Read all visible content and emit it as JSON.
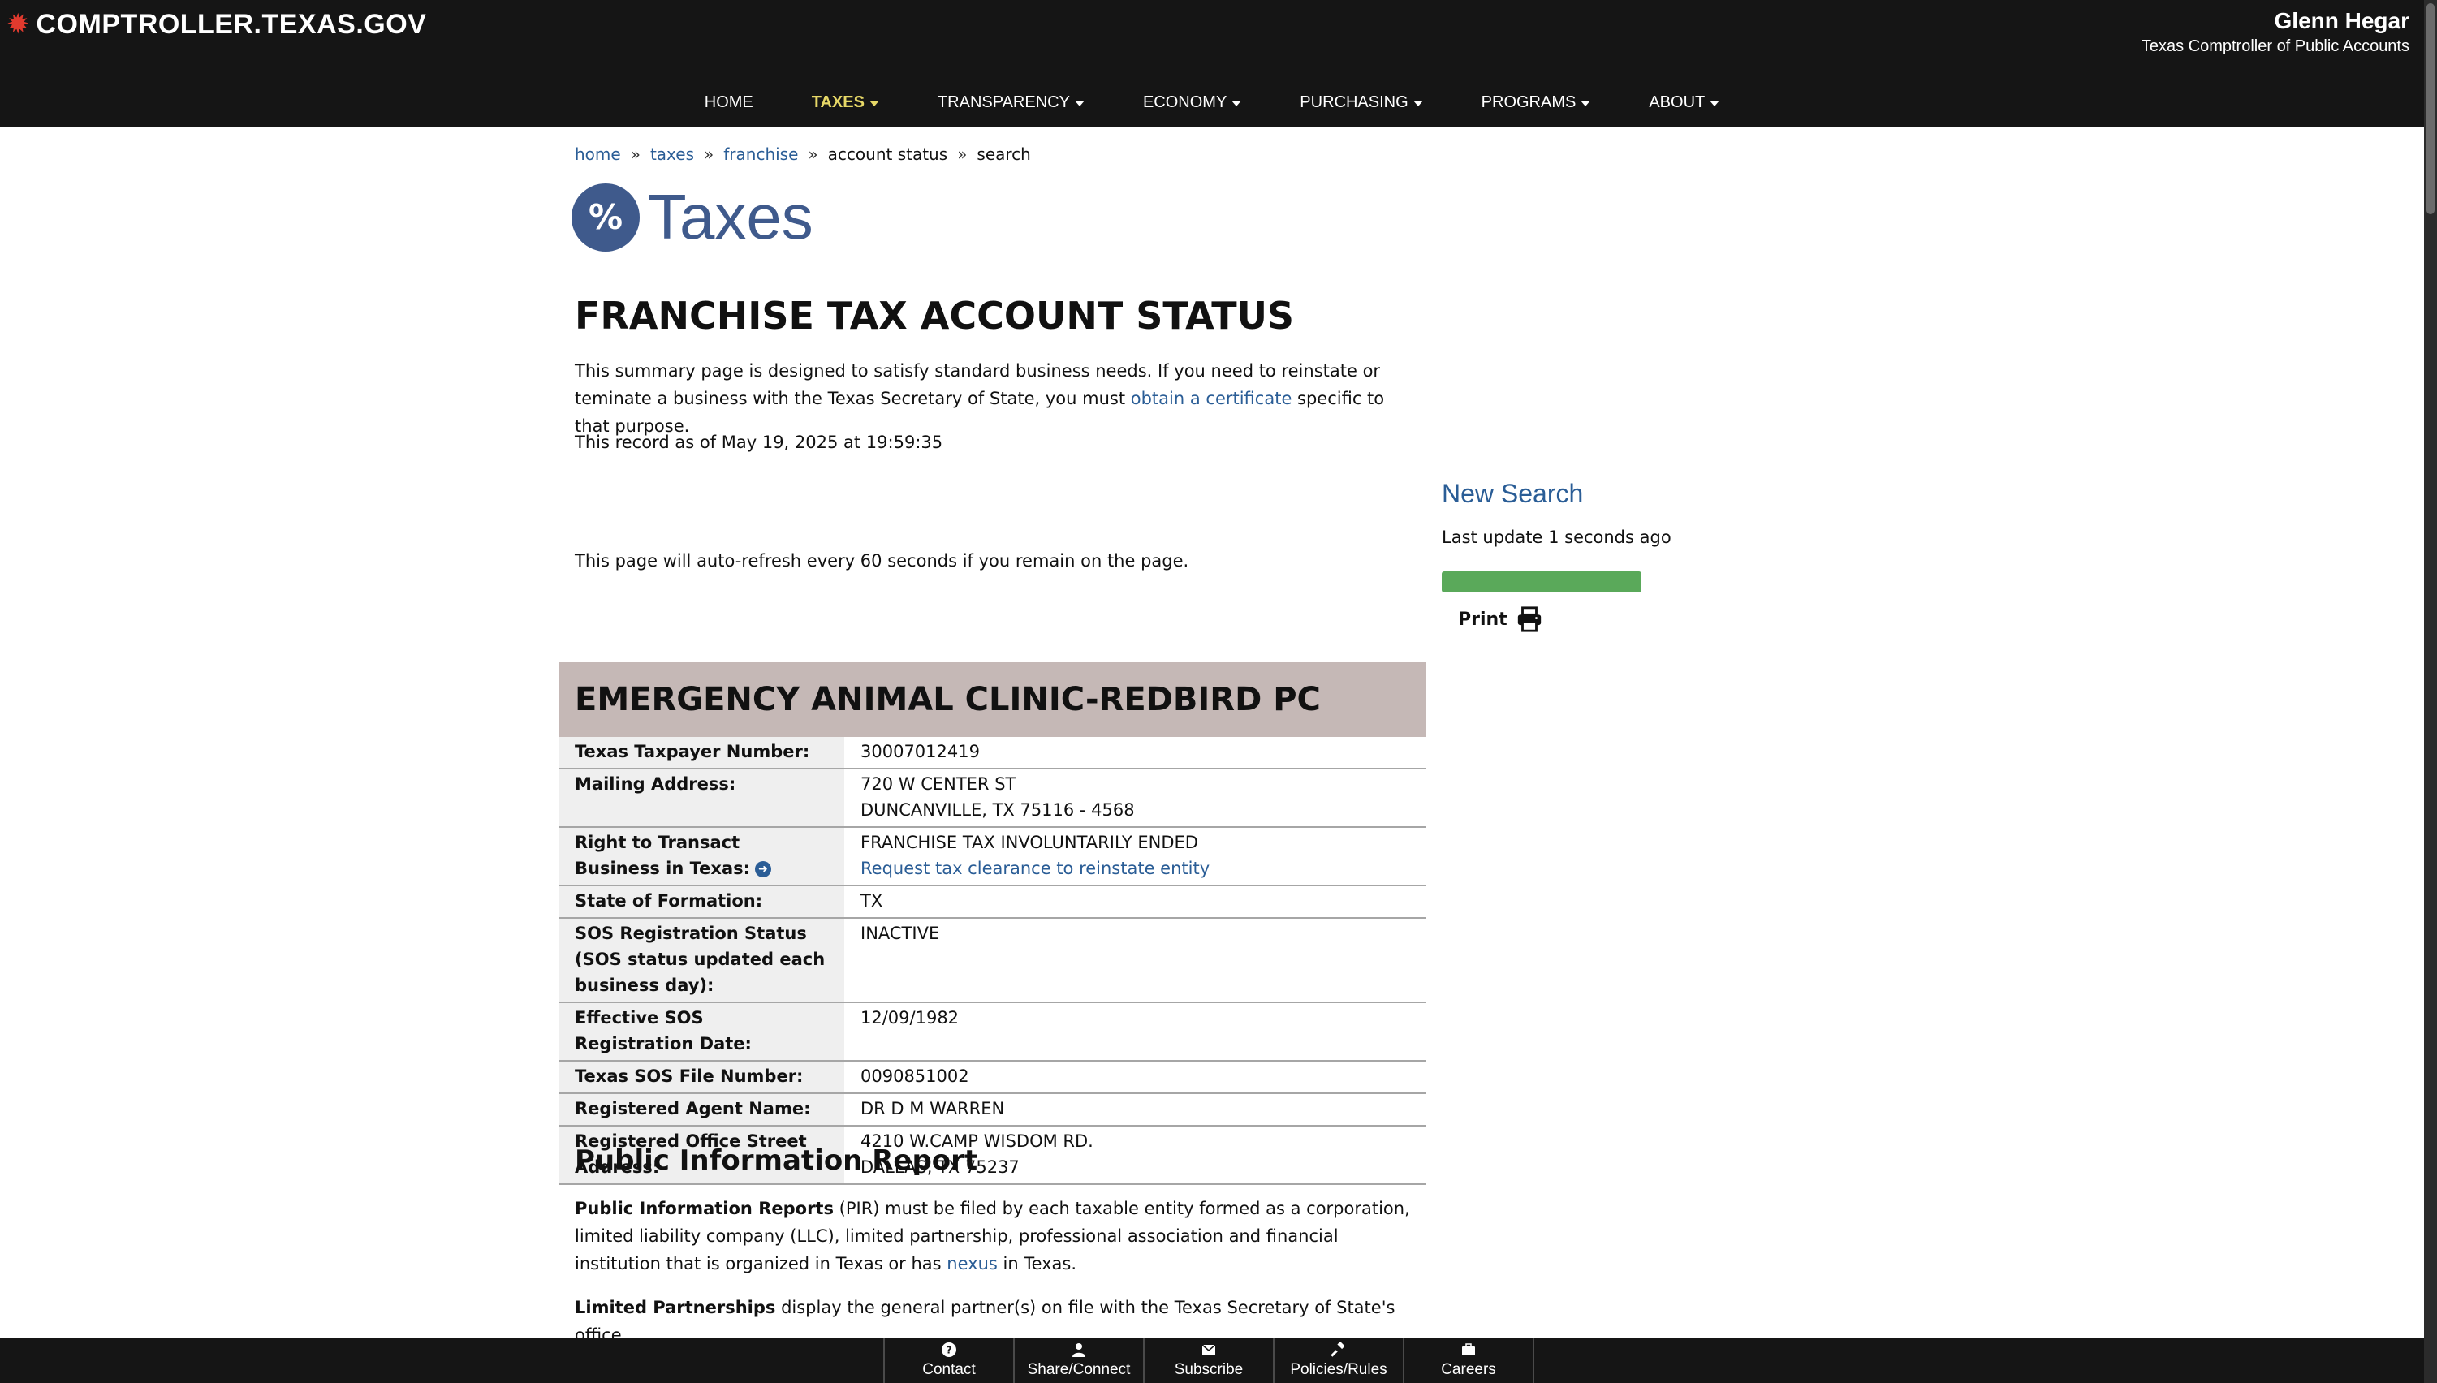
{
  "header": {
    "logo_text": "COMPTROLLER.TEXAS.GOV",
    "user_name": "Glenn Hegar",
    "user_title": "Texas Comptroller of Public Accounts"
  },
  "nav": [
    "HOME",
    "TAXES",
    "TRANSPARENCY",
    "ECONOMY",
    "PURCHASING",
    "PROGRAMS",
    "ABOUT"
  ],
  "breadcrumb": [
    "home",
    "taxes",
    "franchise",
    "account status",
    "search"
  ],
  "section": {
    "icon": "%",
    "label": "Taxes"
  },
  "page_title": "FRANCHISE TAX ACCOUNT STATUS",
  "intro": {
    "text_before": "This summary page is designed to satisfy standard business needs. If you need to reinstate or teminate a business with the Texas Secretary of State, you must ",
    "link": "obtain a certificate",
    "text_after": " specific to that purpose."
  },
  "record_as_of": "This record as of May 19, 2025 at 19:59:35",
  "auto_refresh": "This page will auto-refresh every 60 seconds if you remain on the page.",
  "sidebar": {
    "new_search": "New Search",
    "last_update": "Last update 1 seconds ago",
    "progress_percent": 100,
    "progress_color": "#5aa95a",
    "print_label": "Print"
  },
  "entity": {
    "name": "EMERGENCY ANIMAL CLINIC-REDBIRD PC",
    "rows": [
      {
        "label": "Texas Taxpayer Number:",
        "value": "30007012419"
      },
      {
        "label": "Mailing Address:",
        "value": "720 W CENTER ST",
        "value2": "DUNCANVILLE, TX 75116 - 4568"
      },
      {
        "label": "Right to Transact Business in Texas:",
        "value": "FRANCHISE TAX INVOLUNTARILY ENDED",
        "link": "Request tax clearance to reinstate entity"
      },
      {
        "label": "State of Formation:",
        "value": "TX"
      },
      {
        "label": "SOS Registration Status (SOS status updated each business day):",
        "value": "INACTIVE"
      },
      {
        "label": "Effective SOS Registration Date:",
        "value": "12/09/1982"
      },
      {
        "label": "Texas SOS File Number:",
        "value": "0090851002"
      },
      {
        "label": "Registered Agent Name:",
        "value": "DR D M WARREN"
      },
      {
        "label": "Registered Office Street Address:",
        "value": "4210 W.CAMP WISDOM RD.",
        "value2": "DALLAS, TX 75237"
      }
    ]
  },
  "pir": {
    "title": "Public Information Report",
    "p1_bold": "Public Information Reports",
    "p1_text": " (PIR) must be filed by each taxable entity formed as a corporation, limited liability company (LLC), limited partnership, professional association and financial institution that is organized in Texas or has ",
    "p1_link": "nexus",
    "p1_end": " in Texas.",
    "p2_bold": "Limited Partnerships",
    "p2_text": " display the general partner(s) on file with the Texas Secretary of State's office"
  },
  "footer": [
    "Contact",
    "Share/Connect",
    "Subscribe",
    "Policies/Rules",
    "Careers"
  ],
  "colors": {
    "header_bg": "#151515",
    "brand_blue": "#3f5a8c",
    "link": "#2a5d96",
    "banner": "#c5b8b6",
    "nav_active": "#e7d867"
  }
}
